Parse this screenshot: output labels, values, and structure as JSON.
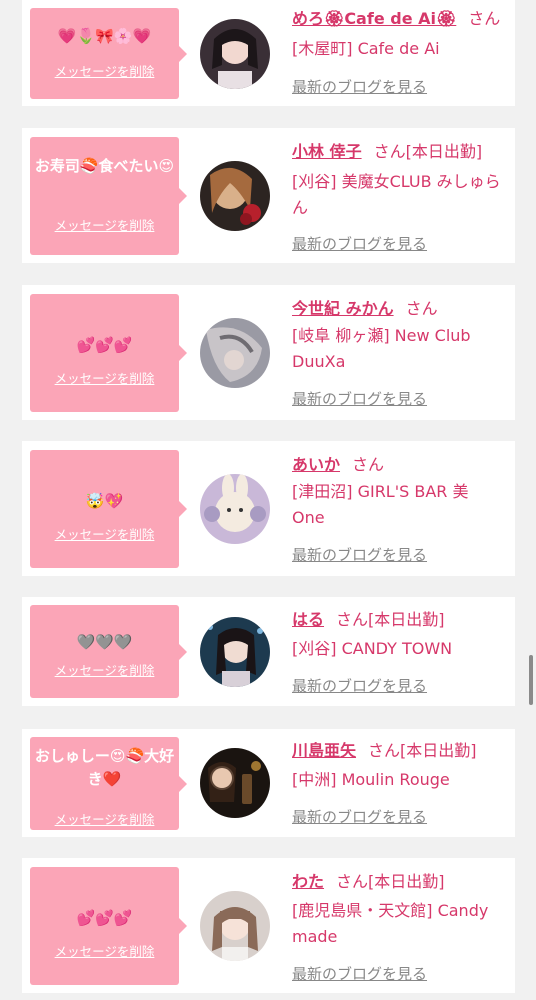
{
  "delete_label": "メッセージを削除",
  "blog_label": "最新のブログを見る",
  "san": "さん",
  "colors": {
    "accent": "#d6386a",
    "bubble": "#fba5b7",
    "background": "#f1f1f1"
  },
  "entries": [
    {
      "message": "💗🌷🎀🌸💗",
      "name": "めろ🏵Cafe de Ai🏵",
      "status": "",
      "shop": "[木屋町] Cafe de Ai"
    },
    {
      "message": "お寿司🍣食べたい😍",
      "name": "小林 倖子",
      "status": "[本日出勤]",
      "shop": "[刈谷] 美魔女CLUB みしゅらん"
    },
    {
      "message": "💕💕💕",
      "name": "今世紀 みかん",
      "status": "",
      "shop": "[岐阜 柳ヶ瀬] New Club DuuXa"
    },
    {
      "message": "🤯💖",
      "name": "あいか",
      "status": "",
      "shop": "[津田沼] GIRL'S BAR 美One"
    },
    {
      "message": "🩶🩶🩶",
      "name": "はる",
      "status": "[本日出勤]",
      "shop": "[刈谷] CANDY TOWN"
    },
    {
      "message": "おしゅしー😍🍣大好き❤️",
      "name": "川島亜矢",
      "status": "[本日出勤]",
      "shop": "[中洲] Moulin Rouge"
    },
    {
      "message": "💕💕💕",
      "name": "わた",
      "status": "[本日出勤]",
      "shop": "[鹿児島県・天文館] Candy made"
    }
  ]
}
